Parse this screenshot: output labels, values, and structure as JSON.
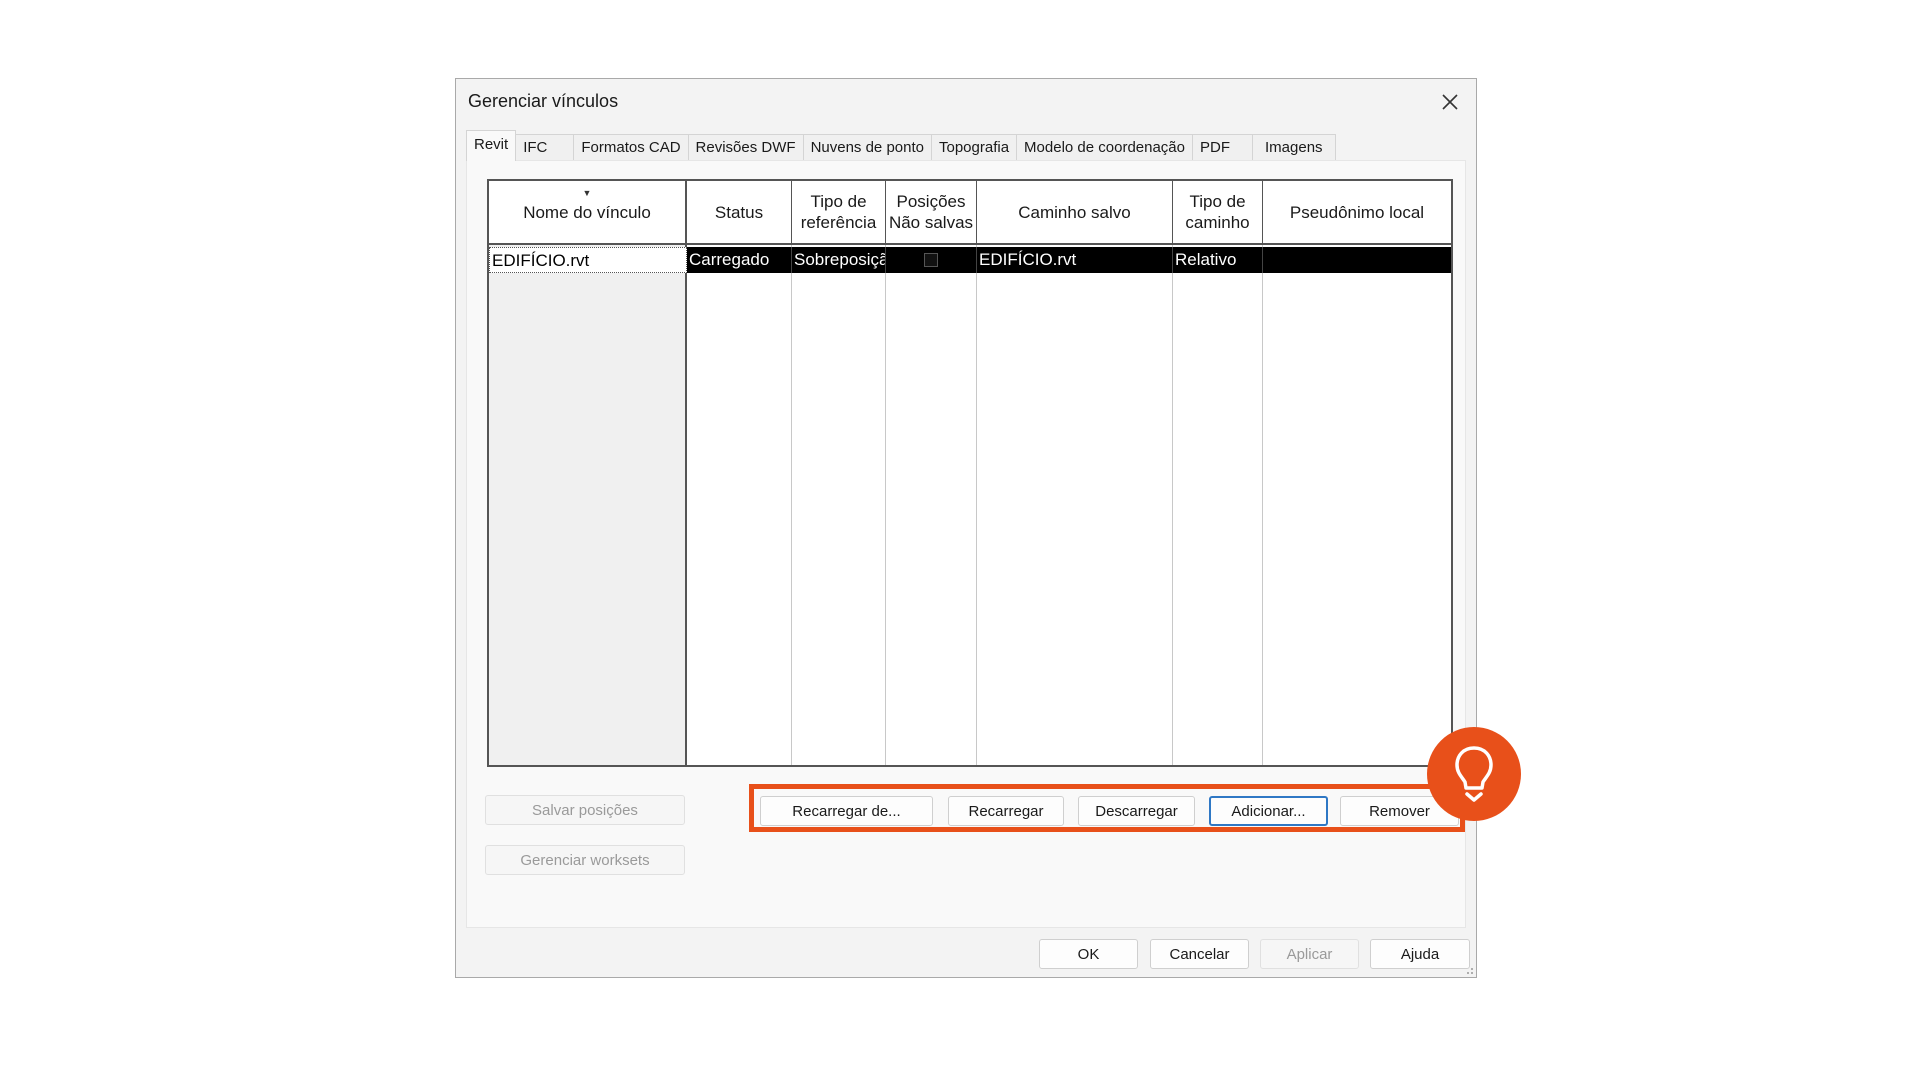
{
  "dialog": {
    "title": "Gerenciar vínculos"
  },
  "tabs": [
    {
      "label": "Revit",
      "active": true
    },
    {
      "label": "IFC"
    },
    {
      "label": "Formatos CAD"
    },
    {
      "label": "Revisões DWF"
    },
    {
      "label": "Nuvens de ponto"
    },
    {
      "label": "Topografia"
    },
    {
      "label": "Modelo de coordenação"
    },
    {
      "label": "PDF"
    },
    {
      "label": "Imagens"
    }
  ],
  "table": {
    "columns": {
      "name": "Nome do vínculo",
      "status": "Status",
      "ref_type_1": "Tipo de",
      "ref_type_2": "referência",
      "positions_1": "Posições",
      "positions_2": "Não salvas",
      "saved_path": "Caminho salvo",
      "path_type_1": "Tipo de",
      "path_type_2": "caminho",
      "alias": "Pseudônimo local"
    },
    "rows": [
      {
        "name": "EDIFÍCIO.rvt",
        "status": "Carregado",
        "ref_type": "Sobreposição",
        "positions_unsaved": false,
        "saved_path": "EDIFÍCIO.rvt",
        "path_type": "Relativo",
        "alias": ""
      }
    ]
  },
  "side_buttons": {
    "save_positions": "Salvar posições",
    "manage_worksets": "Gerenciar worksets"
  },
  "action_buttons": {
    "reload_from": "Recarregar de...",
    "reload": "Recarregar",
    "unload": "Descarregar",
    "add": "Adicionar...",
    "remove": "Remover"
  },
  "footer_buttons": {
    "ok": "OK",
    "cancel": "Cancelar",
    "apply": "Aplicar",
    "help": "Ajuda"
  },
  "colors": {
    "highlight": "#e8501a",
    "selected_row": "#000000",
    "default_button_border": "#2f78c5"
  },
  "icons": {
    "close": "close-icon",
    "hint": "lightbulb-icon"
  }
}
